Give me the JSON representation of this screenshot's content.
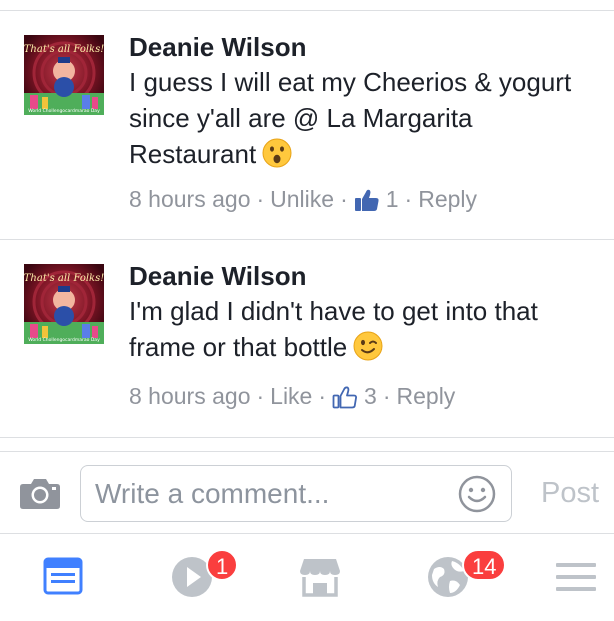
{
  "comments": [
    {
      "author": "Deanie Wilson",
      "text": "I guess I will eat my Cheerios & yogurt since y'all are @ La Margarita Restaurant",
      "emoji": "astonished-face",
      "time": "8 hours ago",
      "action": "Unlike",
      "reactions": "1",
      "reply": "Reply",
      "avatar_text": "That's all Folks!",
      "avatar_caption": "World Chollengocardmarao Day"
    },
    {
      "author": "Deanie Wilson",
      "text": "I'm glad I didn't have to get into that frame or that bottle",
      "emoji": "winking-face",
      "time": "8 hours ago",
      "action": "Like",
      "reactions": "3",
      "reply": "Reply",
      "avatar_text": "That's all Folks!",
      "avatar_caption": "World Chollengocardmarao Day"
    }
  ],
  "composer": {
    "placeholder": "Write a comment...",
    "post_label": "Post"
  },
  "tabbar": {
    "video_badge": "1",
    "notifications_badge": "14"
  },
  "colors": {
    "like_blue": "#4267b2",
    "active_tab": "#4080ff",
    "badge_red": "#fa3e3e",
    "meta_gray": "#90949c"
  },
  "icons": [
    "camera-icon",
    "smiley-icon",
    "news-feed-icon",
    "video-icon",
    "marketplace-icon",
    "globe-icon",
    "menu-icon",
    "thumbs-up-icon"
  ]
}
